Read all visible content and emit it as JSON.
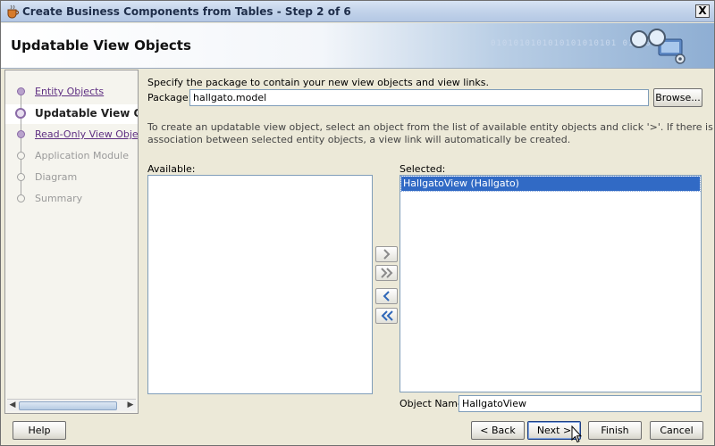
{
  "window": {
    "title": "Create Business Components from Tables - Step 2 of 6",
    "close_glyph": "X"
  },
  "banner": {
    "heading": "Updatable View Objects",
    "binary_text": "0101010101010101010101 01010010"
  },
  "nav": {
    "steps": [
      {
        "label": "Entity Objects",
        "state": "link"
      },
      {
        "label": "Updatable View Objects",
        "state": "current"
      },
      {
        "label": "Read-Only View Objects",
        "state": "link"
      },
      {
        "label": "Application Module",
        "state": "disabled"
      },
      {
        "label": "Diagram",
        "state": "disabled"
      },
      {
        "label": "Summary",
        "state": "disabled"
      }
    ]
  },
  "main": {
    "intro": "Specify the package to contain your new view objects and view links.",
    "package_label": "Package:",
    "package_value": "hallgato.model",
    "browse_label": "Browse...",
    "instructions_line1": "To create an updatable view object, select an object from the list of available entity objects and click '>'.  If there is an",
    "instructions_line2": "association between selected entity objects, a view link will automatically be created.",
    "available_label": "Available:",
    "available_items": [],
    "selected_label": "Selected:",
    "selected_items": [
      "HallgatoView (Hallgato)"
    ],
    "object_name_label": "Object Name:",
    "object_name_value": "HallgatoView"
  },
  "shuttle": {
    "move_right": "move-right-icon",
    "move_all_right": "move-all-right-icon",
    "move_left": "move-left-icon",
    "move_all_left": "move-all-left-icon"
  },
  "footer": {
    "help": "Help",
    "back": "< Back",
    "next": "Next >",
    "finish": "Finish",
    "cancel": "Cancel"
  },
  "colors": {
    "selection": "#316ac5",
    "link": "#5e2e82"
  }
}
